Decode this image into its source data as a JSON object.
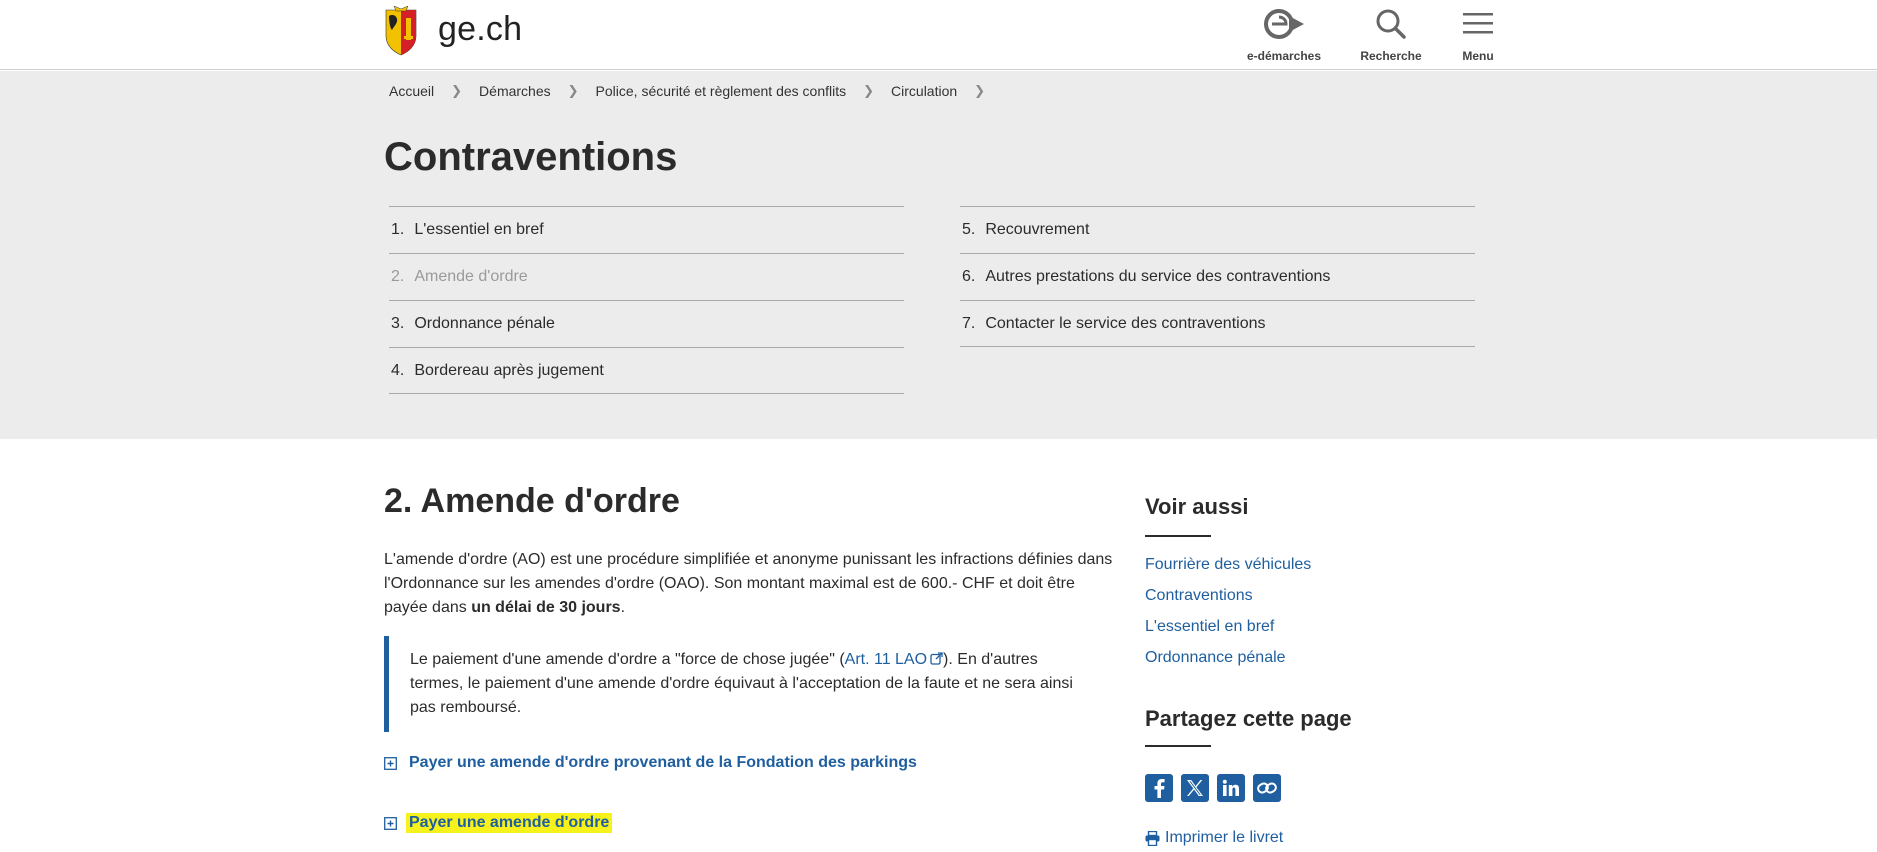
{
  "header": {
    "site_name": "ge.ch",
    "edemarches_label": "e-démarches",
    "search_label": "Recherche",
    "menu_label": "Menu"
  },
  "breadcrumb": [
    "Accueil",
    "Démarches",
    "Police, sécurité et règlement des conflits",
    "Circulation"
  ],
  "page_title": "Contraventions",
  "toc": {
    "left": [
      {
        "num": "1.",
        "label": "L'essentiel en bref",
        "current": false
      },
      {
        "num": "2.",
        "label": "Amende d'ordre",
        "current": true
      },
      {
        "num": "3.",
        "label": "Ordonnance pénale",
        "current": false
      },
      {
        "num": "4.",
        "label": "Bordereau après jugement",
        "current": false
      }
    ],
    "right": [
      {
        "num": "5.",
        "label": "Recouvrement",
        "current": false
      },
      {
        "num": "6.",
        "label": "Autres prestations du service des contraventions",
        "current": false
      },
      {
        "num": "7.",
        "label": "Contacter le service des contraventions",
        "current": false
      }
    ]
  },
  "main": {
    "section_title": "2. Amende d'ordre",
    "intro_pre": "L'amende d'ordre (AO) est une procédure simplifiée et anonyme punissant les infractions définies dans l'Ordonnance sur les amendes d'ordre (OAO). Son montant maximal est de 600.- CHF et doit être payée dans ",
    "intro_bold": "un délai de 30 jours",
    "intro_post": ".",
    "quote_pre": "Le paiement d'une amende d'ordre a \"force de chose jugée\" (",
    "quote_link": "Art. 11 LAO",
    "quote_post": "). En d'autres termes, le paiement d'une amende d'ordre équivaut à l'acceptation de la faute et ne sera ainsi pas remboursé.",
    "accordion_1": "Payer une amende d'ordre provenant de la Fondation des parkings",
    "accordion_2": "Payer une amende d'ordre"
  },
  "sidebar": {
    "see_also_title": "Voir aussi",
    "links": [
      "Fourrière des véhicules",
      "Contraventions",
      "L'essentiel en bref",
      "Ordonnance pénale"
    ],
    "share_title": "Partagez cette page",
    "social": [
      "facebook-icon",
      "x-icon",
      "linkedin-icon",
      "link-icon"
    ],
    "print_label": "Imprimer le livret"
  },
  "colors": {
    "link": "#1f5fa0",
    "band": "#ececec",
    "highlight": "#f7f21c"
  }
}
